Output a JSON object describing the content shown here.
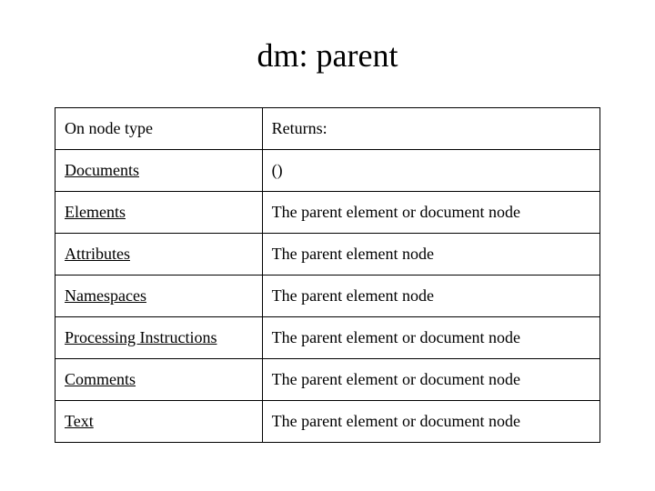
{
  "title": "dm: parent",
  "headers": {
    "col1": "On node type",
    "col2": "Returns:"
  },
  "rows": [
    {
      "type": "Documents",
      "returns": "()"
    },
    {
      "type": "Elements",
      "returns": "The parent element or document node"
    },
    {
      "type": "Attributes",
      "returns": "The parent element node"
    },
    {
      "type": "Namespaces",
      "returns": "The parent element node"
    },
    {
      "type": "Processing Instructions",
      "returns": "The parent element or document node"
    },
    {
      "type": "Comments",
      "returns": "The parent element or document node"
    },
    {
      "type": "Text",
      "returns": "The parent element or document node"
    }
  ],
  "chart_data": {
    "type": "table",
    "title": "dm: parent",
    "columns": [
      "On node type",
      "Returns:"
    ],
    "rows": [
      [
        "Documents",
        "()"
      ],
      [
        "Elements",
        "The parent element or document node"
      ],
      [
        "Attributes",
        "The parent element node"
      ],
      [
        "Namespaces",
        "The parent element node"
      ],
      [
        "Processing Instructions",
        "The parent element or document node"
      ],
      [
        "Comments",
        "The parent element or document node"
      ],
      [
        "Text",
        "The parent element or document node"
      ]
    ]
  }
}
